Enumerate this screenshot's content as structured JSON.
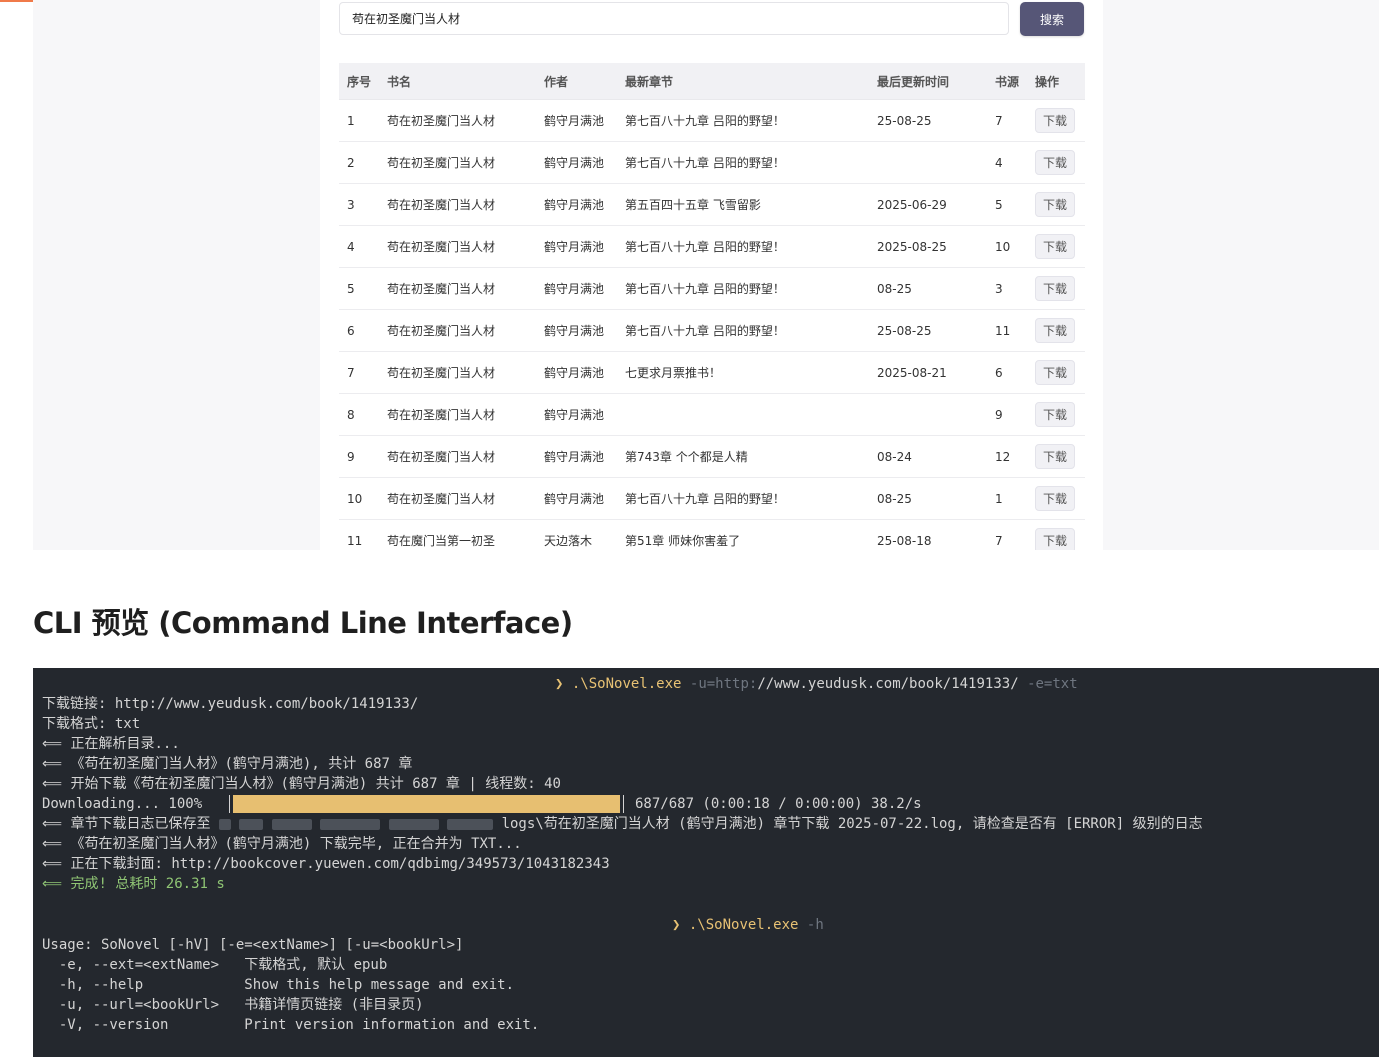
{
  "search": {
    "query": "苟在初圣魔门当人材",
    "button_label": "搜索"
  },
  "table": {
    "headers": [
      "序号",
      "书名",
      "作者",
      "最新章节",
      "最后更新时间",
      "书源",
      "操作"
    ],
    "rows": [
      [
        "1",
        "苟在初圣魔门当人材",
        "鹤守月满池",
        "第七百八十九章 吕阳的野望！",
        "25-08-25",
        "7",
        "下载"
      ],
      [
        "2",
        "苟在初圣魔门当人材",
        "鹤守月满池",
        "第七百八十九章 吕阳的野望！",
        "",
        "4",
        "下载"
      ],
      [
        "3",
        "苟在初圣魔门当人材",
        "鹤守月满池",
        "第五百四十五章 飞雪留影",
        "2025-06-29",
        "5",
        "下载"
      ],
      [
        "4",
        "苟在初圣魔门当人材",
        "鹤守月满池",
        "第七百八十九章 吕阳的野望！",
        "2025-08-25",
        "10",
        "下载"
      ],
      [
        "5",
        "苟在初圣魔门当人材",
        "鹤守月满池",
        "第七百八十九章 吕阳的野望！",
        "08-25",
        "3",
        "下载"
      ],
      [
        "6",
        "苟在初圣魔门当人材",
        "鹤守月满池",
        "第七百八十九章 吕阳的野望！",
        "25-08-25",
        "11",
        "下载"
      ],
      [
        "7",
        "苟在初圣魔门当人材",
        "鹤守月满池",
        "七更求月票推书！",
        "2025-08-21",
        "6",
        "下载"
      ],
      [
        "8",
        "苟在初圣魔门当人材",
        "鹤守月满池",
        "",
        "",
        "9",
        "下载"
      ],
      [
        "9",
        "苟在初圣魔门当人材",
        "鹤守月满池",
        "第743章 个个都是人精",
        "08-24",
        "12",
        "下载"
      ],
      [
        "10",
        "苟在初圣魔门当人材",
        "鹤守月满池",
        "第七百八十九章 吕阳的野望！",
        "08-25",
        "1",
        "下载"
      ],
      [
        "11",
        "苟在魔门当第一初圣",
        "天边落木",
        "第51章 师妹你害羞了",
        "25-08-18",
        "7",
        "下载"
      ]
    ]
  },
  "section_heading": "CLI 预览 (Command Line Interface)",
  "terminal": {
    "prompt1": {
      "symbol": "❯",
      "command": ".\\SoNovel.exe",
      "arg1_flag": "-u=http:",
      "arg1_value": "//www.yeudusk.com/book/1419133/",
      "arg2": "-e=txt"
    },
    "lines": [
      "下载链接: http://www.yeudusk.com/book/1419133/",
      "下载格式: txt",
      "⟸ 正在解析目录...",
      "⟸ 《苟在初圣魔门当人材》(鹤守月满池), 共计 687 章",
      "⟸ 开始下载《苟在初圣魔门当人材》(鹤守月满池) 共计 687 章 | 线程数: 40"
    ],
    "progress": {
      "label": "Downloading... 100%",
      "fraction": 1.0,
      "stats": "687/687 (0:00:18 / 0:00:00) 38.2/s"
    },
    "log_line_prefix": "⟸ 章节下载日志已保存至",
    "log_line_suffix": "logs\\苟在初圣魔门当人材 (鹤守月满池) 章节下载 2025-07-22.log, 请检查是否有 [ERROR] 级别的日志",
    "merge_line": "⟸ 《苟在初圣魔门当人材》(鹤守月满池) 下载完毕, 正在合并为 TXT...",
    "cover_line": "⟸ 正在下载封面: http://bookcover.yuewen.com/qdbimg/349573/1043182343",
    "done_line": "⟸ 完成! 总耗时 26.31 s",
    "prompt2": {
      "symbol": "❯",
      "command": ".\\SoNovel.exe",
      "arg": "-h"
    },
    "usage_lines": [
      "Usage: SoNovel [-hV] [-e=<extName>] [-u=<bookUrl>]",
      "  -e, --ext=<extName>   下载格式, 默认 epub",
      "  -h, --help            Show this help message and exit.",
      "  -u, --url=<bookUrl>   书籍详情页链接 (非目录页)",
      "  -V, --version         Print version information and exit."
    ]
  },
  "colors": {
    "accent_orange": "#f07a4a",
    "button_bg": "#565677",
    "terminal_bg": "#24282e",
    "prompt_yellow": "#e8c274",
    "progress_fill": "#e7bf71",
    "success_green": "#8fc574"
  }
}
